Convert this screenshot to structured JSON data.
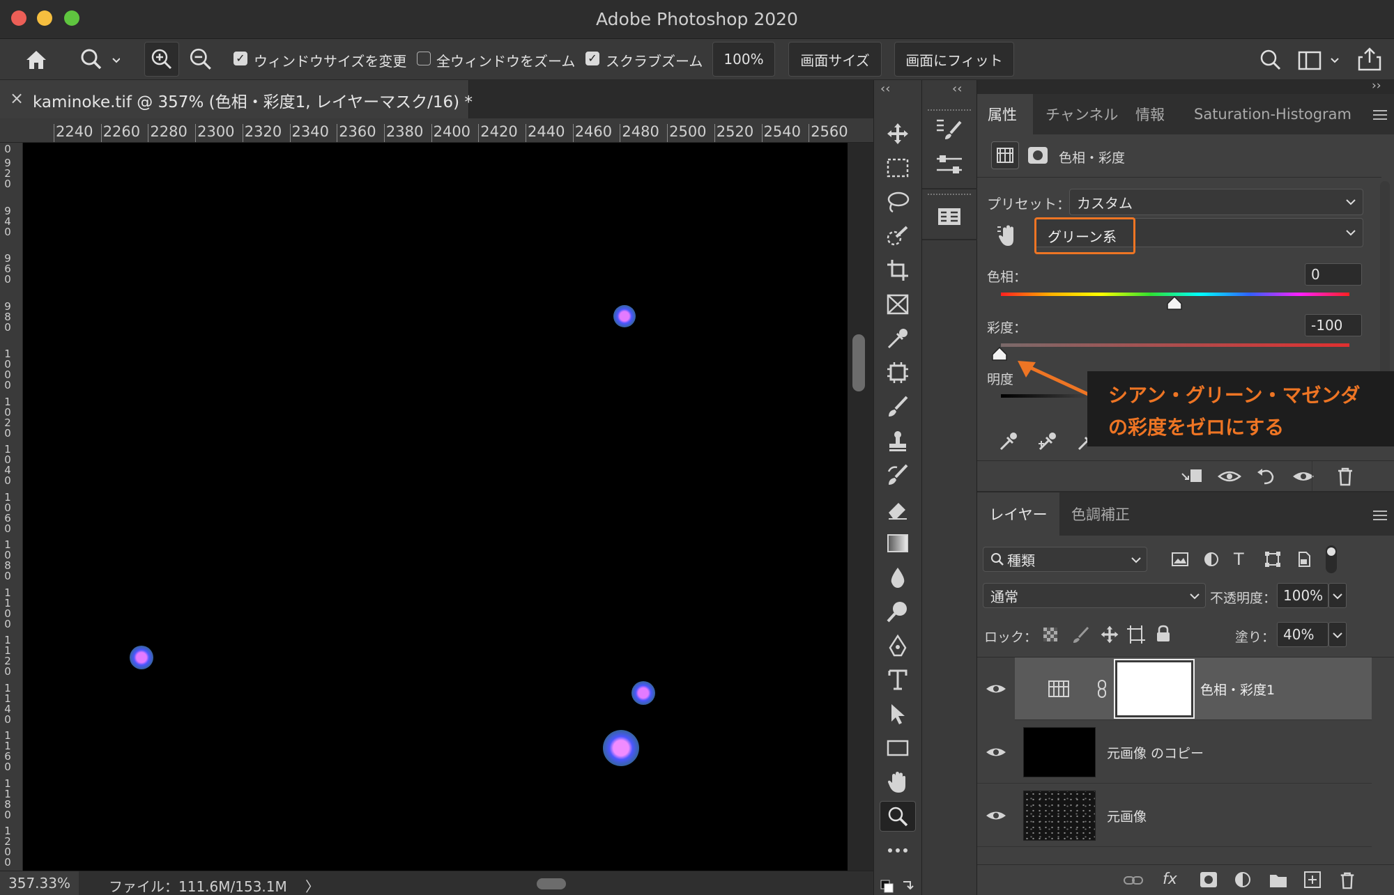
{
  "window": {
    "title": "Adobe Photoshop 2020",
    "traffic_light_colors": [
      "#ec5f57",
      "#f5be3f",
      "#5fc53f"
    ]
  },
  "options_bar": {
    "checkboxes": [
      {
        "label": "ウィンドウサイズを変更",
        "checked": true
      },
      {
        "label": "全ウィンドウをズーム",
        "checked": false
      },
      {
        "label": "スクラブズーム",
        "checked": true
      }
    ],
    "zoom_button": "100%",
    "fit_screen_button": "画面サイズ",
    "fill_screen_button": "画面にフィット",
    "icons": [
      "home-icon",
      "zoom-tool-icon",
      "zoom-in-icon",
      "zoom-out-icon",
      "search-icon",
      "workspace-icon",
      "share-icon"
    ]
  },
  "document": {
    "tab_title": "kaminoke.tif @ 357% (色相・彩度1, レイヤーマスク/16) *",
    "close_glyph": "×",
    "ruler_h": [
      "2240",
      "2260",
      "2280",
      "2300",
      "2320",
      "2340",
      "2360",
      "2380",
      "2400",
      "2420",
      "2440",
      "2460",
      "2480",
      "2500",
      "2520",
      "2540",
      "2560"
    ],
    "ruler_v": [
      "920",
      "940",
      "960",
      "980",
      "1000",
      "1020",
      "1040",
      "1060",
      "1080",
      "1100",
      "1120",
      "1140",
      "1160",
      "1180",
      "1200"
    ],
    "ruler_v_top": "0",
    "canvas_background": "#000000",
    "star_color": "#4a57ff"
  },
  "status_bar": {
    "zoom": "357.33%",
    "file_info": "ファイル：111.6M/153.1M",
    "arrow": "〉"
  },
  "properties": {
    "collapse_left": "‹‹",
    "collapse_right": "››",
    "tabs": [
      "属性",
      "チャンネル",
      "情報",
      "Saturation-Histogram"
    ],
    "active_tab": "属性",
    "adjustment_title": "色相・彩度",
    "preset_label": "プリセット：",
    "preset_value": "カスタム",
    "channel_value": "グリーン系",
    "hue_label": "色相：",
    "hue_value": "0",
    "saturation_label": "彩度：",
    "saturation_value": "-100",
    "lightness_label": "明度",
    "highlight_color": "#ee7524"
  },
  "callout": {
    "line1": "シアン・グリーン・マゼンダ",
    "line2": "の彩度をゼロにする"
  },
  "layers": {
    "tabs": [
      "レイヤー",
      "色調補正"
    ],
    "filter_label": "種類",
    "blend_mode": "通常",
    "opacity_label": "不透明度：",
    "opacity_value": "100%",
    "lock_label": "ロック：",
    "fill_label": "塗り：",
    "fill_value": "40%",
    "items": [
      {
        "name": "色相・彩度1",
        "selected": true
      },
      {
        "name": "元画像 のコピー",
        "selected": false
      },
      {
        "name": "元画像",
        "selected": false
      }
    ],
    "footer_fx": "fx"
  }
}
